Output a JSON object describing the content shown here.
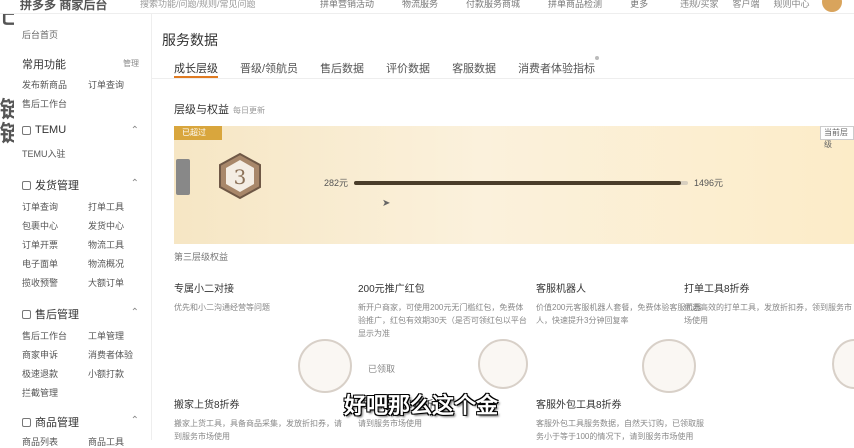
{
  "topbar": {
    "logo": "拼多多 商家后台",
    "search_placeholder": "搜索功能/问题/规则/常见问题",
    "links": [
      "拼单营销活动",
      "物流服务",
      "付款服务商城",
      "拼单商品检测"
    ],
    "more": "更多",
    "right": [
      "违规/买家",
      "客户端",
      "规则中心"
    ]
  },
  "leftedge": [
    "己",
    "链",
    "链"
  ],
  "sidebar": {
    "home": "后台首页",
    "common": {
      "title": "常用功能",
      "manage": "管理",
      "items": [
        "发布新商品",
        "订单查询",
        "售后工作台"
      ]
    },
    "temu": {
      "title": "TEMU",
      "items": [
        "TEMU入驻"
      ]
    },
    "shipping": {
      "title": "发货管理",
      "items": [
        "订单查询",
        "打单工具",
        "包裹中心",
        "发货中心",
        "订单开票",
        "物流工具",
        "电子面单",
        "物流概况",
        "揽收预警",
        "大额订单"
      ]
    },
    "aftersale": {
      "title": "售后管理",
      "items": [
        "售后工作台",
        "工单管理",
        "商家申诉",
        "消费者体验",
        "极速退款",
        "小额打款",
        "拦截管理"
      ]
    },
    "goods": {
      "title": "商品管理",
      "items": [
        "商品列表",
        "商品工具"
      ]
    }
  },
  "main": {
    "title": "服务数据",
    "tabs": [
      "成长层级",
      "晋级/领航员",
      "售后数据",
      "评价数据",
      "客服数据",
      "消费者体验指标"
    ],
    "level_section_title": "层级与权益",
    "level_section_sub": "每日更新",
    "badge_passed": "已超过",
    "level_number": "3",
    "range_start": "282元",
    "range_end": "1496元",
    "progress_fraction": 0.98,
    "current_level_tag": "当前层级",
    "rights_title": "第三层级权益",
    "benefits": [
      {
        "title": "专属小二对接",
        "desc": "优先和小二沟通经营等问题"
      },
      {
        "title": "200元推广红包",
        "desc": "新开户商家，可使用200元无门槛红包，免费体验推广，红包有效期30天（是否可领红包以平台显示为准"
      },
      {
        "title": "客服机器人",
        "desc": "价值200元客服机器人套餐，免费体验客服机器人，快速提升3分钟回复率"
      },
      {
        "title": "打单工具8折券",
        "desc": "优选高效的打单工具，发放折扣券，领到服务市场使用"
      },
      {
        "title": "搬家上货8折券",
        "desc": "搬家上货工具，具备商品采集，发放折扣券，请到服务市场使用"
      },
      {
        "title": "商品优化工具8折券",
        "desc": "请到服务市场使用"
      },
      {
        "title": "客服外包工具8折券",
        "desc": "客服外包工具服务数据，自然天订购，已领取服务小于等于100的情况下，请到服务市场使用"
      }
    ],
    "claimed_label": "已领取"
  },
  "subtitle": "好吧那么这个金",
  "colors": {
    "accent": "#e07b22",
    "gold": "#d9a63d",
    "card_bg": "#fbf1dc"
  }
}
